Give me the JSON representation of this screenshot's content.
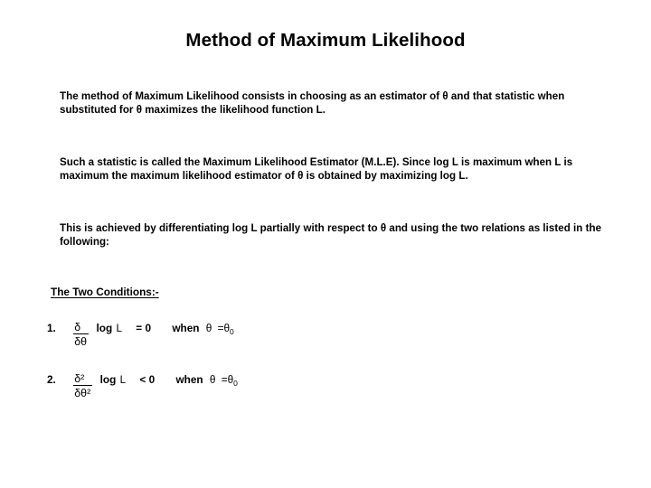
{
  "slide": {
    "title": "Method of Maximum Likelihood",
    "paragraphs": [
      "The method of Maximum Likelihood consists in choosing as an estimator of θ and that statistic when substituted for θ maximizes the likelihood function L.",
      "Such a statistic is called the Maximum Likelihood Estimator (M.L.E). Since log L is maximum when L is maximum the maximum likelihood estimator of θ is obtained by maximizing log L.",
      "This is achieved by differentiating log L partially with respect to θ and using the two relations as listed in the following:"
    ],
    "conditions_heading": "The Two Conditions:-",
    "conditions": [
      {
        "number": "1.",
        "numerator": "δ",
        "denominator": "δθ",
        "function": "log",
        "variable": "L",
        "operator": "= 0",
        "when_label": "when",
        "when_variable": "θ",
        "when_value": "=θ",
        "when_subscript": "0"
      },
      {
        "number": "2.",
        "numerator": "δ²",
        "denominator": "δθ²",
        "function": "log",
        "variable": "L",
        "operator": "< 0",
        "when_label": "when",
        "when_variable": "θ",
        "when_value": "=θ",
        "when_subscript": "0"
      }
    ]
  },
  "colors": {
    "background": "#ffffff",
    "text": "#000000"
  }
}
